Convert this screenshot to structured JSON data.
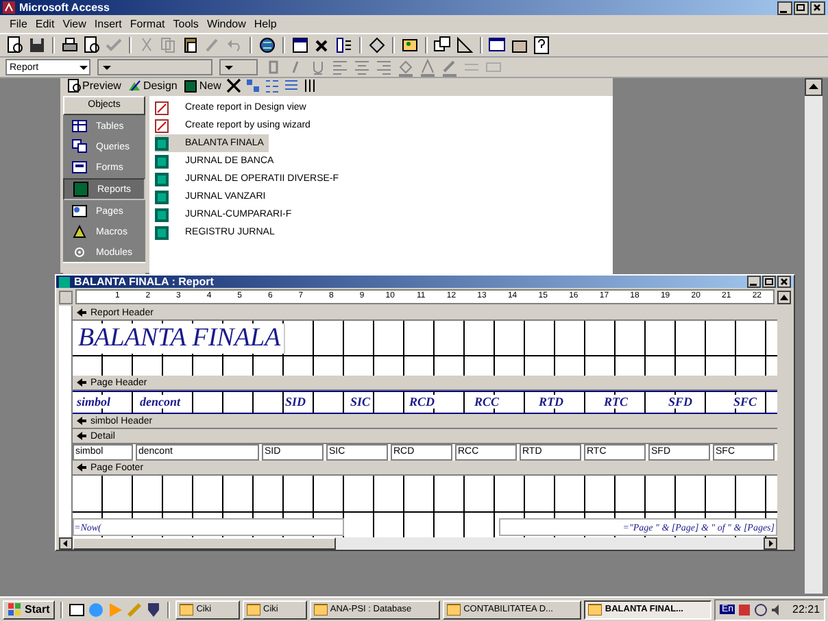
{
  "window": {
    "title": "Microsoft Access"
  },
  "menu": [
    "File",
    "Edit",
    "View",
    "Insert",
    "Format",
    "Tools",
    "Window",
    "Help"
  ],
  "format_toolbar": {
    "object_combo": "Report"
  },
  "database_window": {
    "toolbar": [
      "Preview",
      "Design",
      "New"
    ],
    "objects_header": "Objects",
    "object_groups": [
      {
        "label": "Tables",
        "selected": false
      },
      {
        "label": "Queries",
        "selected": false
      },
      {
        "label": "Forms",
        "selected": false
      },
      {
        "label": "Reports",
        "selected": true
      },
      {
        "label": "Pages",
        "selected": false
      },
      {
        "label": "Macros",
        "selected": false
      },
      {
        "label": "Modules",
        "selected": false
      }
    ],
    "items": [
      {
        "label": "Create report in Design view",
        "kind": "shortcut",
        "selected": false
      },
      {
        "label": "Create report by using wizard",
        "kind": "shortcut",
        "selected": false
      },
      {
        "label": "BALANTA FINALA",
        "kind": "report",
        "selected": true
      },
      {
        "label": "JURNAL DE BANCA",
        "kind": "report",
        "selected": false
      },
      {
        "label": "JURNAL DE OPERATII DIVERSE-F",
        "kind": "report",
        "selected": false
      },
      {
        "label": "JURNAL VANZARI",
        "kind": "report",
        "selected": false
      },
      {
        "label": "JURNAL-CUMPARARI-F",
        "kind": "report",
        "selected": false
      },
      {
        "label": "REGISTRU JURNAL",
        "kind": "report",
        "selected": false
      }
    ]
  },
  "report_window": {
    "title": "BALANTA FINALA : Report",
    "ruler_marks": [
      "1",
      "2",
      "3",
      "4",
      "5",
      "6",
      "7",
      "8",
      "9",
      "10",
      "11",
      "12",
      "13",
      "14",
      "15",
      "16",
      "17",
      "18",
      "19",
      "20",
      "21",
      "22"
    ],
    "sections": [
      {
        "label": "Report Header",
        "kind": "report_header",
        "controls": [
          "BALANTA FINALA"
        ]
      },
      {
        "label": "Page Header",
        "kind": "page_header",
        "controls": [
          "simbol",
          "dencont",
          "SID",
          "SIC",
          "RCD",
          "RCC",
          "RTD",
          "RTC",
          "SFD",
          "SFC"
        ]
      },
      {
        "label": "simbol Header",
        "kind": "group_header"
      },
      {
        "label": "Detail",
        "kind": "detail",
        "controls": [
          "simbol",
          "dencont",
          "SID",
          "SIC",
          "RCD",
          "RCC",
          "RTD",
          "RTC",
          "SFD",
          "SFC"
        ]
      },
      {
        "label": "Page Footer",
        "kind": "page_footer",
        "controls": [
          "=Now(",
          "=\"Page \" & [Page] & \" of \" & [Pages]"
        ]
      }
    ]
  },
  "taskbar": {
    "start": "Start",
    "tasks": [
      {
        "label": "Ciki",
        "selected": false
      },
      {
        "label": "Ciki",
        "selected": false
      },
      {
        "label": "ANA-PSI : Database",
        "selected": false
      },
      {
        "label": "CONTABILITATEA D...",
        "selected": false
      },
      {
        "label": "BALANTA FINAL...",
        "selected": true
      }
    ],
    "language": "En",
    "clock": "22:21"
  }
}
